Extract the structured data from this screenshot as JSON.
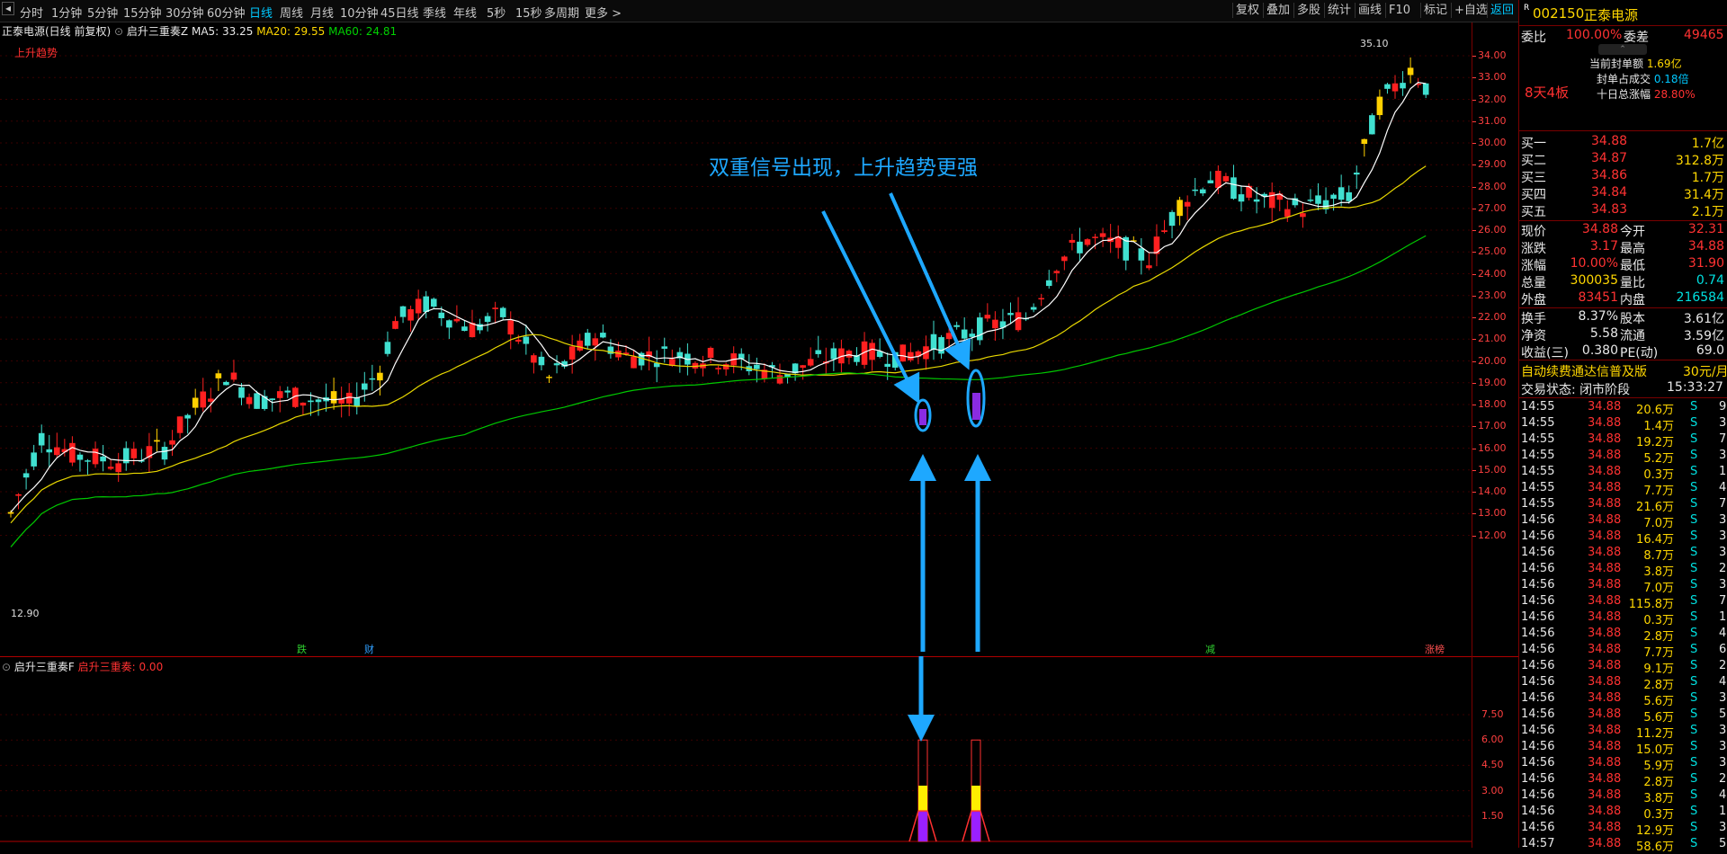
{
  "toolbar": {
    "periods": [
      "分时",
      "1分钟",
      "5分钟",
      "15分钟",
      "30分钟",
      "60分钟",
      "日线",
      "周线",
      "月线",
      "10分钟",
      "45日线",
      "季线",
      "年线",
      "5秒",
      "15秒",
      "多周期",
      "更多 >"
    ],
    "active_period": "日线",
    "right_buttons": [
      "复权",
      "叠加",
      "多股",
      "统计",
      "画线",
      "F10",
      "标记",
      "+自选",
      "返回"
    ]
  },
  "chart": {
    "title": "正泰电源(日线 前复权)",
    "indicator_name": "启升三重奏Z",
    "ma5_label": "MA5: 33.25",
    "ma20_label": "MA20: 29.55",
    "ma60_label": "MA60: 24.81",
    "trend_label": "上升趋势",
    "annotation": "双重信号出现，上升趋势更强",
    "high_label": "35.10",
    "low_label": "12.90",
    "markers": [
      "跌",
      "财",
      "减",
      "涨榜"
    ],
    "price_axis": [
      "34.00",
      "33.00",
      "32.00",
      "31.00",
      "30.00",
      "29.00",
      "28.00",
      "27.00",
      "26.00",
      "25.00",
      "24.00",
      "23.00",
      "22.00",
      "21.00",
      "20.00",
      "19.00",
      "18.00",
      "17.00",
      "16.00",
      "15.00",
      "14.00",
      "13.00",
      "12.00"
    ],
    "colors": {
      "up": "#ff2020",
      "down": "#40e0d0",
      "ma5": "#ffffff",
      "ma20": "#e8d800",
      "ma60": "#00c800",
      "yellow_bar": "#ffd000",
      "arrow": "#1ea8ff"
    }
  },
  "sub_chart": {
    "name": "启升三重奏F",
    "value_label": "启升三重奏: 0.00",
    "axis": [
      "7.50",
      "6.00",
      "4.50",
      "3.00",
      "1.50"
    ]
  },
  "chart_data": {
    "type": "bar",
    "description_source": "sub-indicator signal bars",
    "series": [
      {
        "name": "启升三重奏",
        "values": [
          6.0,
          6.0
        ]
      }
    ],
    "ylim": [
      0,
      8
    ]
  },
  "panel": {
    "code": "002150",
    "name": "正泰电源",
    "weibi_label": "委比",
    "weibi": "100.00%",
    "weicha_label": "委差",
    "weicha": "49465",
    "board": "8天4板",
    "seal_items": [
      {
        "label": "当前封单额",
        "value": "1.69亿"
      },
      {
        "label": "封单占成交",
        "value": "0.18倍"
      },
      {
        "label": "十日总涨幅",
        "value": "28.80%"
      }
    ],
    "bids": [
      {
        "label": "买一",
        "price": "34.88",
        "vol": "1.7亿"
      },
      {
        "label": "买二",
        "price": "34.87",
        "vol": "312.8万"
      },
      {
        "label": "买三",
        "price": "34.86",
        "vol": "1.7万"
      },
      {
        "label": "买四",
        "price": "34.84",
        "vol": "31.4万"
      },
      {
        "label": "买五",
        "price": "34.83",
        "vol": "2.1万"
      }
    ],
    "quote": [
      {
        "l1": "现价",
        "v1": "34.88",
        "l2": "今开",
        "v2": "32.31"
      },
      {
        "l1": "涨跌",
        "v1": "3.17",
        "l2": "最高",
        "v2": "34.88"
      },
      {
        "l1": "涨幅",
        "v1": "10.00%",
        "l2": "最低",
        "v2": "31.90"
      },
      {
        "l1": "总量",
        "v1": "300035",
        "l2": "量比",
        "v2": "0.74"
      },
      {
        "l1": "外盘",
        "v1": "83451",
        "l2": "内盘",
        "v2": "216584"
      }
    ],
    "fund": [
      {
        "l1": "换手",
        "v1": "8.37%",
        "l2": "股本",
        "v2": "3.61亿"
      },
      {
        "l1": "净资",
        "v1": "5.58",
        "l2": "流通",
        "v2": "3.59亿"
      },
      {
        "l1": "收益(三)",
        "v1": "0.380",
        "l2": "PE(动)",
        "v2": "69.0"
      }
    ],
    "ad_text": "自动续费通达信普及版",
    "ad_price": "30元/月",
    "status_label": "交易状态: 闭市阶段",
    "status_time": "15:33:27",
    "ticks": [
      [
        "14:55",
        "34.88",
        "20.6万",
        "S",
        "9"
      ],
      [
        "14:55",
        "34.88",
        "1.4万",
        "S",
        "3"
      ],
      [
        "14:55",
        "34.88",
        "19.2万",
        "S",
        "7"
      ],
      [
        "14:55",
        "34.88",
        "5.2万",
        "S",
        "3"
      ],
      [
        "14:55",
        "34.88",
        "0.3万",
        "S",
        "1"
      ],
      [
        "14:55",
        "34.88",
        "7.7万",
        "S",
        "4"
      ],
      [
        "14:55",
        "34.88",
        "21.6万",
        "S",
        "7"
      ],
      [
        "14:56",
        "34.88",
        "7.0万",
        "S",
        "3"
      ],
      [
        "14:56",
        "34.88",
        "16.4万",
        "S",
        "3"
      ],
      [
        "14:56",
        "34.88",
        "8.7万",
        "S",
        "3"
      ],
      [
        "14:56",
        "34.88",
        "3.8万",
        "S",
        "2"
      ],
      [
        "14:56",
        "34.88",
        "7.0万",
        "S",
        "3"
      ],
      [
        "14:56",
        "34.88",
        "115.8万",
        "S",
        "7"
      ],
      [
        "14:56",
        "34.88",
        "0.3万",
        "S",
        "1"
      ],
      [
        "14:56",
        "34.88",
        "2.8万",
        "S",
        "4"
      ],
      [
        "14:56",
        "34.88",
        "7.7万",
        "S",
        "6"
      ],
      [
        "14:56",
        "34.88",
        "9.1万",
        "S",
        "2"
      ],
      [
        "14:56",
        "34.88",
        "2.8万",
        "S",
        "4"
      ],
      [
        "14:56",
        "34.88",
        "5.6万",
        "S",
        "3"
      ],
      [
        "14:56",
        "34.88",
        "5.6万",
        "S",
        "5"
      ],
      [
        "14:56",
        "34.88",
        "11.2万",
        "S",
        "3"
      ],
      [
        "14:56",
        "34.88",
        "15.0万",
        "S",
        "3"
      ],
      [
        "14:56",
        "34.88",
        "5.9万",
        "S",
        "3"
      ],
      [
        "14:56",
        "34.88",
        "2.8万",
        "S",
        "2"
      ],
      [
        "14:56",
        "34.88",
        "3.8万",
        "S",
        "4"
      ],
      [
        "14:56",
        "34.88",
        "0.3万",
        "S",
        "1"
      ],
      [
        "14:56",
        "34.88",
        "12.9万",
        "S",
        "3"
      ],
      [
        "14:57",
        "34.88",
        "58.6万",
        "S",
        "5"
      ]
    ]
  }
}
